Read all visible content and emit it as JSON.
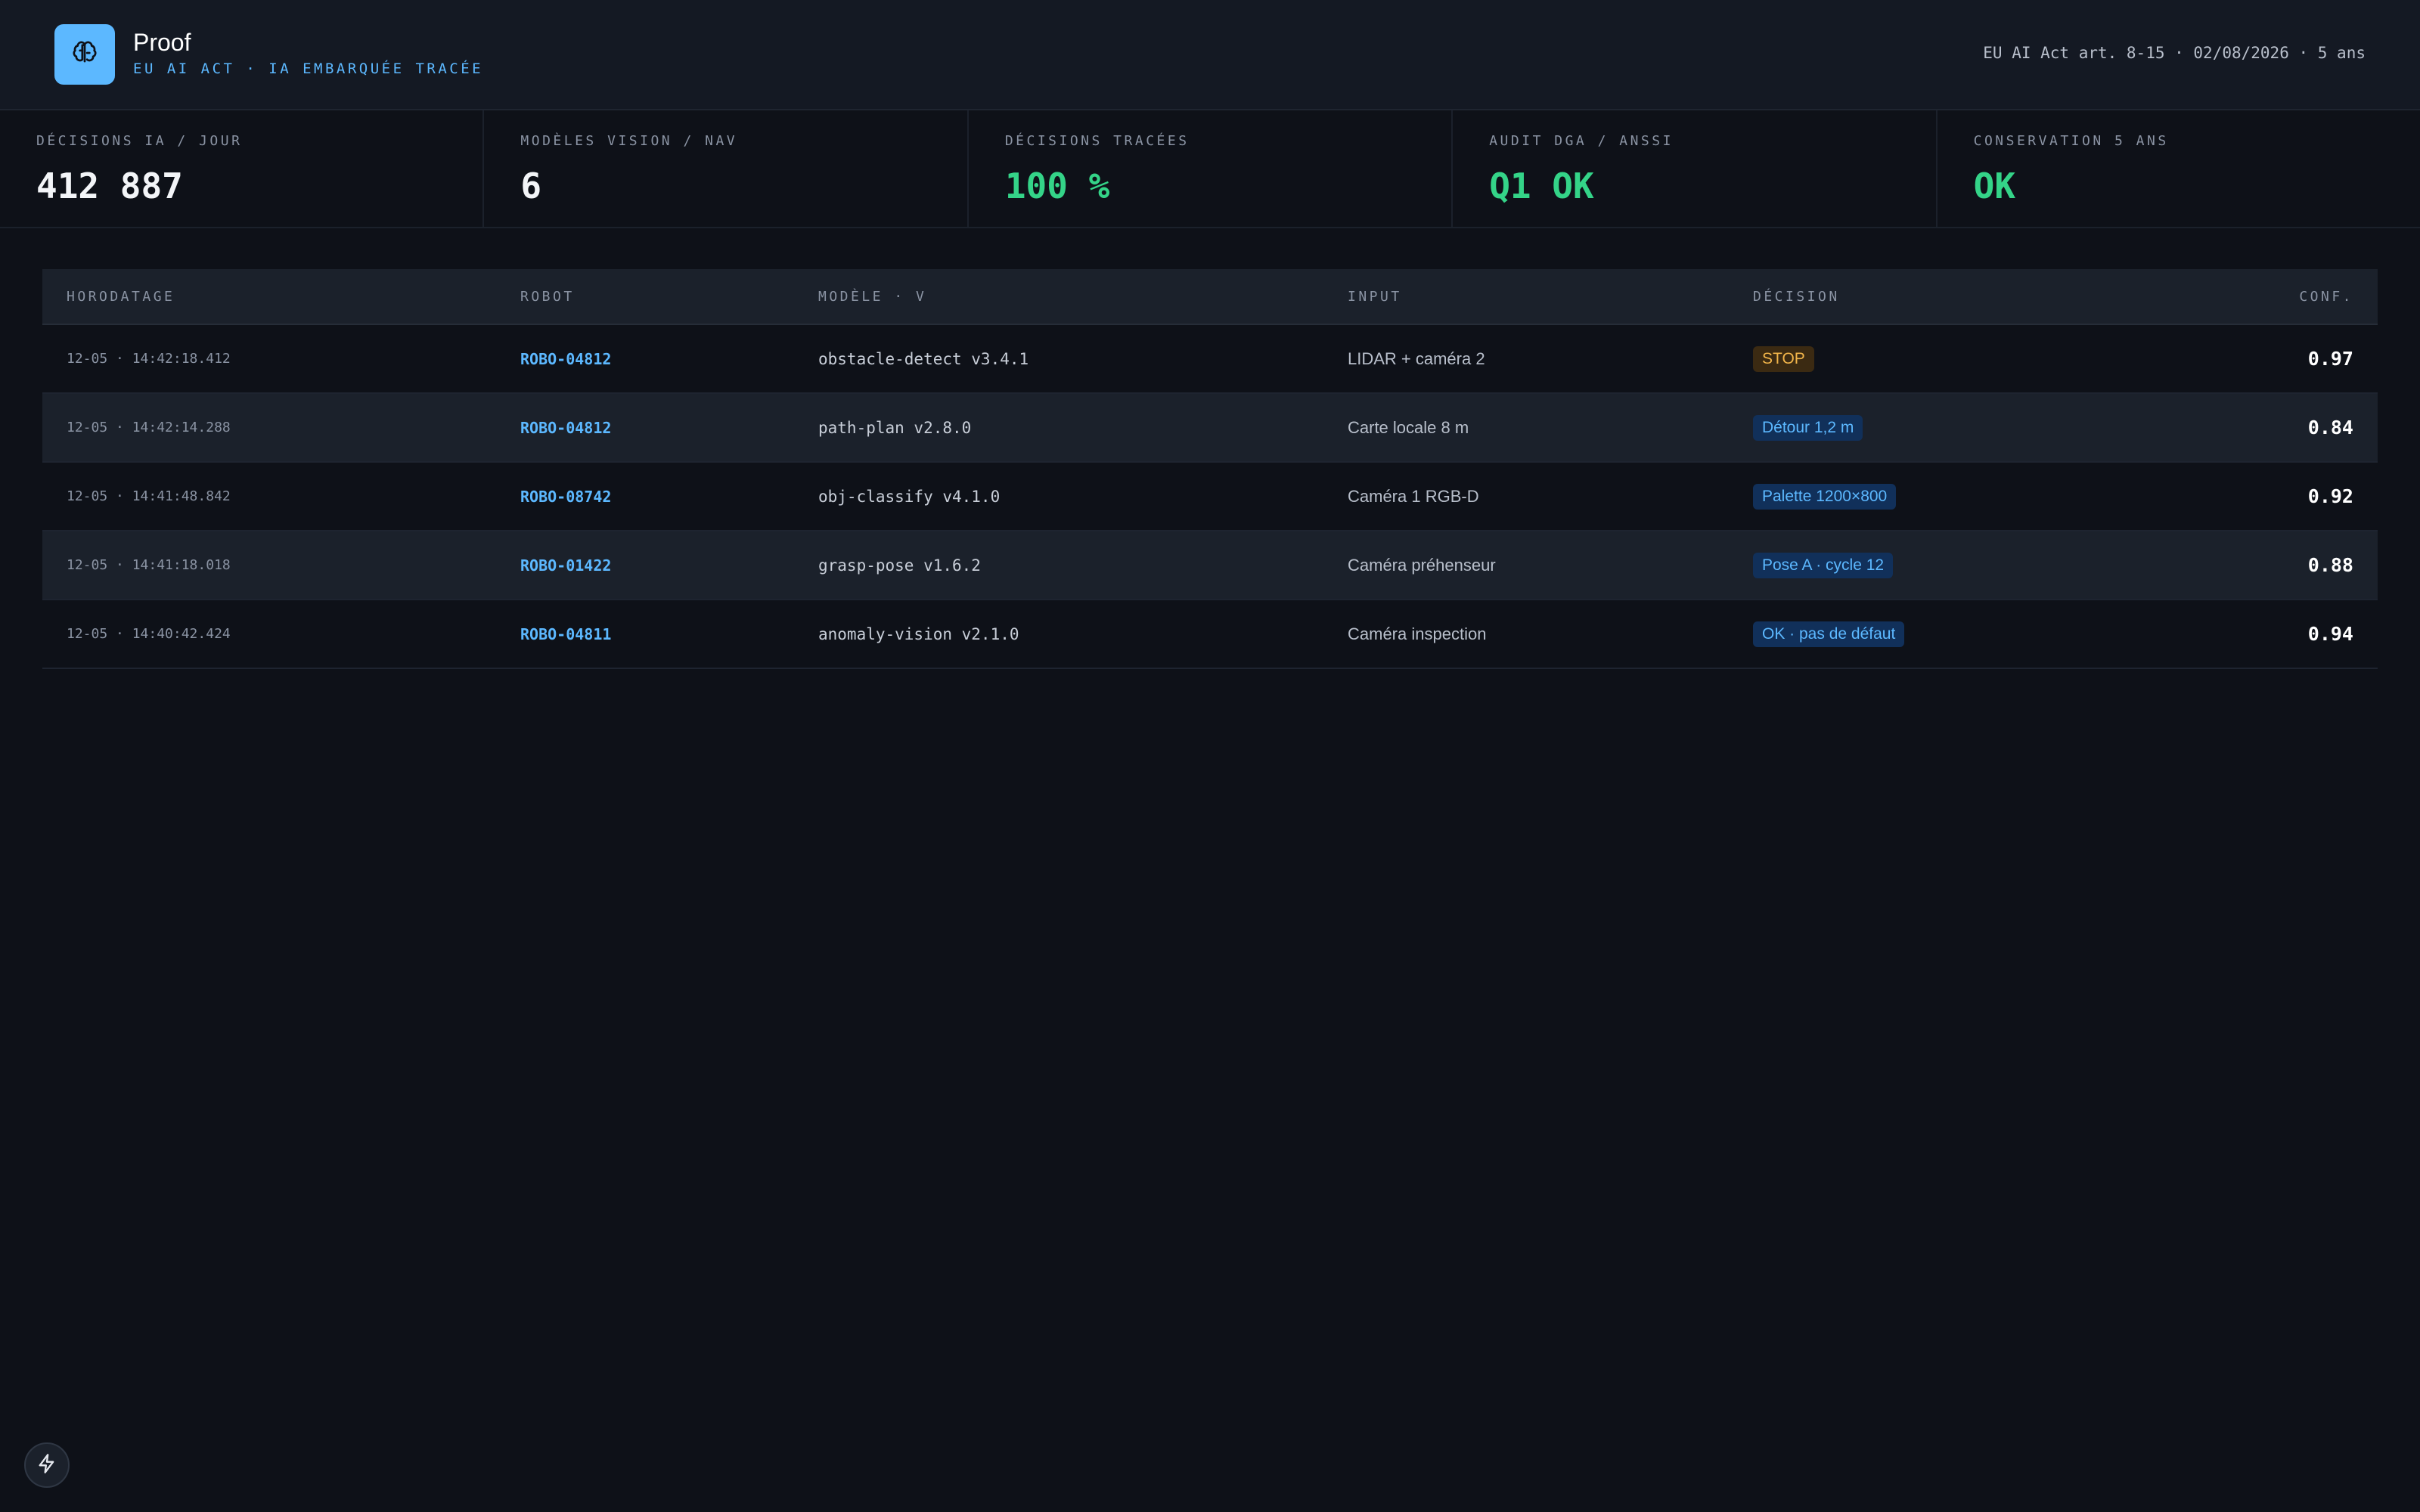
{
  "header": {
    "app_name": "Proof",
    "subtitle": "EU AI ACT · IA EMBARQUÉE TRACÉE",
    "meta": "EU AI Act art. 8-15 · 02/08/2026 · 5 ans",
    "logo_icon": "brain-icon",
    "accent": "#5cb8ff"
  },
  "kpis": [
    {
      "label": "DÉCISIONS IA / JOUR",
      "value": "412 887"
    },
    {
      "label": "MODÈLES VISION / NAV",
      "value": "6"
    },
    {
      "label": "DÉCISIONS TRACÉES",
      "value": "100 %"
    },
    {
      "label": "AUDIT DGA / ANSSI",
      "value": "Q1 OK"
    },
    {
      "label": "CONSERVATION 5 ANS",
      "value": "OK"
    }
  ],
  "table": {
    "columns": [
      "HORODATAGE",
      "ROBOT",
      "MODÈLE · V",
      "INPUT",
      "DÉCISION",
      "CONF."
    ],
    "rows": [
      {
        "time": "12-05 · 14:42:18.412",
        "robot": "ROBO-04812",
        "model": "obstacle-detect v3.4.1",
        "input": "LIDAR + caméra 2",
        "decision": "STOP",
        "decision_kind": "warn",
        "conf": "0.97"
      },
      {
        "time": "12-05 · 14:42:14.288",
        "robot": "ROBO-04812",
        "model": "path-plan v2.8.0",
        "input": "Carte locale 8 m",
        "decision": "Détour 1,2 m",
        "decision_kind": "info",
        "conf": "0.84"
      },
      {
        "time": "12-05 · 14:41:48.842",
        "robot": "ROBO-08742",
        "model": "obj-classify v4.1.0",
        "input": "Caméra 1 RGB-D",
        "decision": "Palette 1200×800",
        "decision_kind": "info",
        "conf": "0.92"
      },
      {
        "time": "12-05 · 14:41:18.018",
        "robot": "ROBO-01422",
        "model": "grasp-pose v1.6.2",
        "input": "Caméra préhenseur",
        "decision": "Pose A · cycle 12",
        "decision_kind": "info",
        "conf": "0.88"
      },
      {
        "time": "12-05 · 14:40:42.424",
        "robot": "ROBO-04811",
        "model": "anomaly-vision v2.1.0",
        "input": "Caméra inspection",
        "decision": "OK · pas de défaut",
        "decision_kind": "info",
        "conf": "0.94"
      }
    ]
  },
  "fab_icon": "bolt-icon",
  "colors": {
    "green": "#34d488",
    "warn": "#f2b54a",
    "info": "#5cb8ff"
  }
}
